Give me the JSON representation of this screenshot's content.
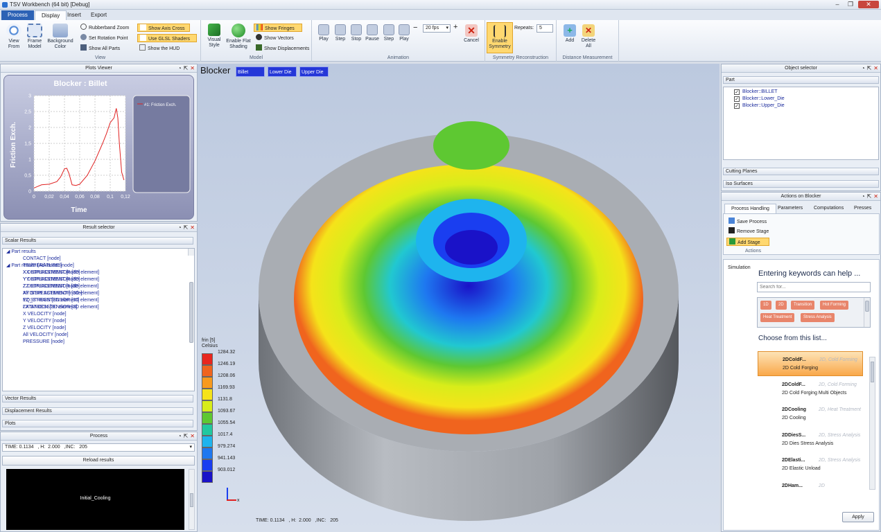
{
  "app": {
    "title": "TSV Workbench (64 bit) [Debug]"
  },
  "tabs": [
    "Process",
    "Display",
    "Insert",
    "Export"
  ],
  "ribbon": {
    "view": {
      "view_from": "View\nFrom",
      "frame_model": "Frame\nModel",
      "background_color": "Background\nColor",
      "rubberband": "Rubberband Zoom",
      "set_rotation": "Set Rotation Point",
      "show_all": "Show All Parts",
      "show_axis": "Show Axis Cross",
      "use_glsl": "Use GLSL Shaders",
      "show_hud": "Show the HUD",
      "label": "View"
    },
    "model": {
      "visual_style": "Visual\nStyle",
      "flat_shading": "Enable Flat\nShading",
      "show_fringes": "Show Fringes",
      "show_vectors": "Show Vectors",
      "show_displacements": "Show Displacements",
      "label": "Model"
    },
    "animation": {
      "play": "Play",
      "step_back": "Step",
      "stop": "Stop",
      "pause": "Pause",
      "step_fwd": "Step",
      "play2": "Play",
      "fps": "20 fps",
      "minus": "−",
      "plus": "+",
      "cancel": "Cancel",
      "label": "Animation"
    },
    "symmetry": {
      "enable": "Enable\nSymmetry",
      "repeats_label": "Repeats:",
      "repeats": "5",
      "label": "Symmetry Reconstruction"
    },
    "distance": {
      "add": "Add",
      "delete": "Delete\nAll",
      "label": "Distance Measurement"
    }
  },
  "plots_viewer": {
    "title": "Plots Viewer",
    "chart_title": "Blocker : Billet",
    "legend": "#1: Friction Exch."
  },
  "chart_data": {
    "type": "line",
    "title": "Blocker : Billet",
    "xlabel": "Time",
    "ylabel": "Friction Exch.",
    "xlim": [
      0,
      0.12
    ],
    "ylim": [
      0,
      3
    ],
    "x_ticks": [
      "0",
      "0,02",
      "0,04",
      "0,06",
      "0,08",
      "0,1",
      "0,12"
    ],
    "y_ticks": [
      "0",
      "0,5",
      "1",
      "1,5",
      "2",
      "2,5",
      "3"
    ],
    "grid": true,
    "legend_position": "right",
    "series": [
      {
        "name": "#1: Friction Exch.",
        "color": "#e02020",
        "x": [
          0,
          0.005,
          0.01,
          0.02,
          0.03,
          0.035,
          0.04,
          0.043,
          0.046,
          0.05,
          0.055,
          0.06,
          0.07,
          0.08,
          0.09,
          0.095,
          0.1,
          0.105,
          0.108,
          0.11,
          0.112,
          0.115,
          0.118
        ],
        "y": [
          0.1,
          0.15,
          0.2,
          0.22,
          0.3,
          0.45,
          0.7,
          0.72,
          0.55,
          0.2,
          0.18,
          0.22,
          0.5,
          0.95,
          1.5,
          1.8,
          2.15,
          2.3,
          2.6,
          2.3,
          1.5,
          0.6,
          0.35
        ]
      }
    ]
  },
  "result_selector": {
    "title": "Result selector",
    "scalar": "Scalar Results",
    "part_results": "Part results",
    "items": [
      "CONTACT [node]",
      "TEMPERATURE [node]",
      "X DISPLACEMENT [node]",
      "Y DISPLACEMENT [node]",
      "Z DISPLACEMENT [node]",
      "All DISPLACEMENT [node]",
      "EQ_STRAIN [3D element]",
      "LATANDCN [3D element]",
      "X VELOCITY [node]",
      "Y VELOCITY [node]",
      "Z VELOCITY [node]",
      "All VELOCITY [node]",
      "PRESSURE [node]"
    ],
    "advanced": "Part results (Advanced)",
    "adv_items": [
      "XX STRESSTENSOR [3D element]",
      "YY STRESSTENSOR [3D element]",
      "ZZ STRESSTENSOR [3D element]",
      "XY STRESSTENSOR [3D element]",
      "YZ STRESSTENSOR [3D element]",
      "ZX STRESSTENSOR [3D element]"
    ],
    "vector": "Vector Results",
    "displacement": "Displacement Results",
    "plots": "Plots"
  },
  "process": {
    "title": "Process",
    "time_combo": "TIME: 0.1134   , H:  2.000   ,INC:   205",
    "reload": "Reload results",
    "stage": "Initial_Cooling"
  },
  "viewport": {
    "title": "Blocker",
    "badges": [
      "Billet",
      "Lower Die",
      "Upper Die"
    ],
    "legend_title": "frin [5]",
    "legend_unit": "Celsius",
    "legend_values": [
      "1284.32",
      "1246.19",
      "1208.06",
      "1169.93",
      "1131.8",
      "1093.67",
      "1055.54",
      "1017.4",
      "979.274",
      "941.143",
      "903.012"
    ],
    "legend_colors": [
      "#e8261e",
      "#f0641e",
      "#f89a1e",
      "#f5e31a",
      "#d8ed1a",
      "#5ec832",
      "#21c8a0",
      "#1eb4ee",
      "#1e78f0",
      "#1a3ef0",
      "#1a12c8"
    ],
    "axis_x": "x",
    "status": "TIME: 0.1134   , H:  2.000   ,INC:   205"
  },
  "object_selector": {
    "title": "Object selector",
    "part": "Part",
    "items": [
      "Blocker::BILLET",
      "Blocker::Lower_Die",
      "Blocker::Upper_Die"
    ],
    "cutting": "Cutting Planes",
    "iso": "Iso Surfaces"
  },
  "actions": {
    "title": "Actions on Blocker",
    "tabs": [
      "Process Handling",
      "Parameters",
      "Computations",
      "Presses"
    ],
    "save": "Save Process",
    "remove": "Remove Stage",
    "add": "Add Stage",
    "group": "Actions"
  },
  "simulation": {
    "label": "Simulation",
    "heading": "Entering keywords can help ...",
    "search_placeholder": "Search for...",
    "tags": [
      "1D",
      "2D",
      "Transition",
      "Hot Forming",
      "Heat Treatment",
      "Stress Analysis"
    ],
    "choose": "Choose from this list...",
    "list": [
      {
        "name": "2DColdF...",
        "cat": "2D, Cold Forming",
        "desc": "2D Cold Forging"
      },
      {
        "name": "2DColdF...",
        "cat": "2D, Cold Forming",
        "desc": "2D Cold Forging Multi Objects"
      },
      {
        "name": "2DCooling",
        "cat": "2D, Heat Treatment",
        "desc": "2D Cooling"
      },
      {
        "name": "2DDiesS...",
        "cat": "2D, Stress Analysis",
        "desc": "2D Dies Stress Analysis"
      },
      {
        "name": "2DElasti...",
        "cat": "2D, Stress Analysis",
        "desc": "2D Elastic Unload"
      },
      {
        "name": "2DHam...",
        "cat": "2D",
        "desc": ""
      }
    ],
    "apply": "Apply"
  }
}
